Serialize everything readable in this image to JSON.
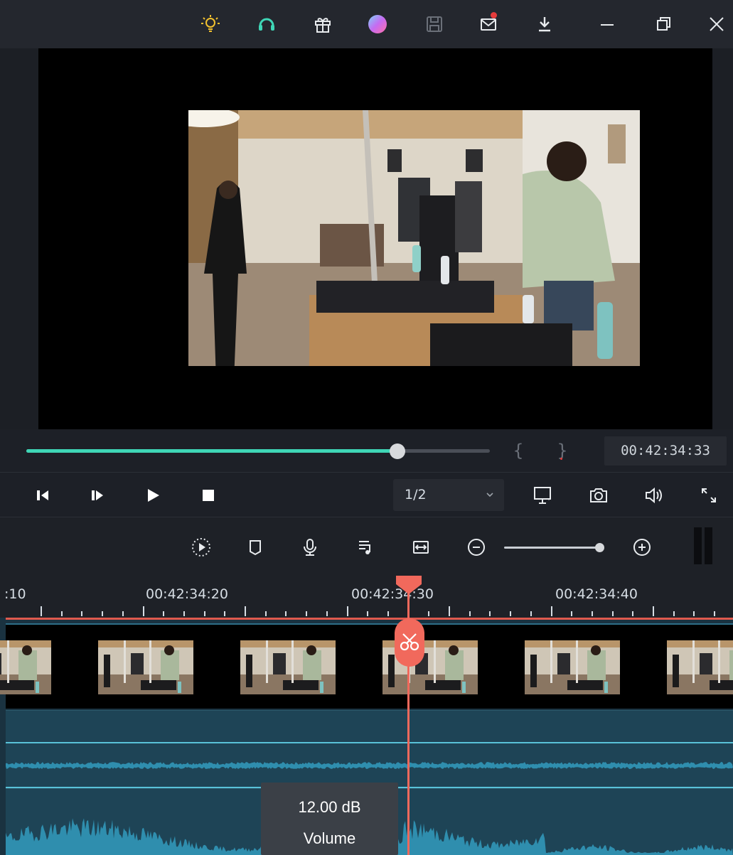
{
  "titlebar": {
    "icons": [
      "lightbulb-icon",
      "headset-support-icon",
      "gift-icon",
      "account-avatar-icon",
      "save-icon",
      "mail-notification-icon",
      "download-icon",
      "minimize-icon",
      "restore-icon",
      "close-icon"
    ],
    "colors": {
      "lightbulb": "#f2c12e",
      "headset": "#3fd6b6",
      "notification_dot": "#e53b3b"
    }
  },
  "preview": {
    "scrub_progress": 0.8,
    "mark_in_label": "{",
    "mark_out_label": "}",
    "timecode": "00:42:34:33"
  },
  "player": {
    "speed": "1/2",
    "controls": [
      "previous-frame-icon",
      "next-frame-icon",
      "play-icon",
      "stop-icon"
    ],
    "right_controls": [
      "display-quality-icon",
      "snapshot-icon",
      "volume-icon",
      "fullscreen-icon"
    ]
  },
  "timeline_toolbar": {
    "tools": [
      "render-preview-icon",
      "marker-icon",
      "voiceover-icon",
      "audio-mixer-icon",
      "fit-timeline-icon",
      "zoom-out-icon",
      "zoom-in-icon"
    ],
    "zoom_level": 0.9
  },
  "ruler": {
    "labels": [
      ":10",
      "00:42:34:20",
      "00:42:34:30",
      "00:42:34:40"
    ]
  },
  "audio_tooltip": {
    "value": "12.00 dB",
    "label": "Volume"
  },
  "theme": {
    "accent": "#3fd6b6",
    "playhead": "#f1695c",
    "audio_wave": "#2f8eae"
  }
}
